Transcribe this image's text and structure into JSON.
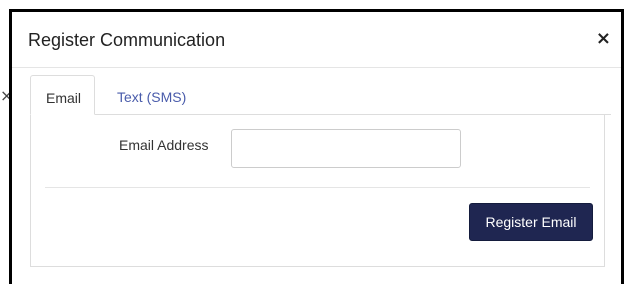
{
  "modal": {
    "title": "Register Communication",
    "close_glyph": "×",
    "close_icon": "close-icon"
  },
  "background": {
    "peek_glyph": "×"
  },
  "tabs": [
    {
      "label": "Email",
      "active": true
    },
    {
      "label": "Text (SMS)",
      "active": false
    }
  ],
  "form": {
    "email_label": "Email Address",
    "email_value": "",
    "submit_label": "Register Email"
  },
  "colors": {
    "primary_button": "#1f2651",
    "tab_link": "#4a5cab"
  }
}
